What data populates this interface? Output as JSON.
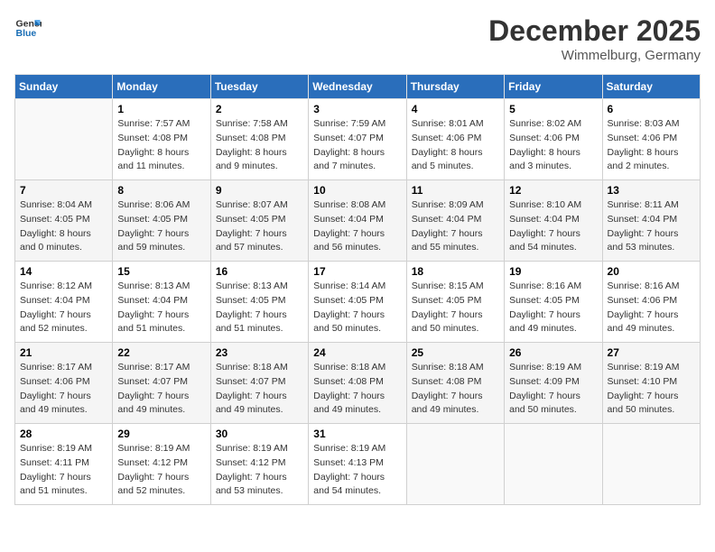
{
  "header": {
    "logo_line1": "General",
    "logo_line2": "Blue",
    "month_title": "December 2025",
    "subtitle": "Wimmelburg, Germany"
  },
  "days_of_week": [
    "Sunday",
    "Monday",
    "Tuesday",
    "Wednesday",
    "Thursday",
    "Friday",
    "Saturday"
  ],
  "weeks": [
    [
      {
        "day": "",
        "info": ""
      },
      {
        "day": "1",
        "info": "Sunrise: 7:57 AM\nSunset: 4:08 PM\nDaylight: 8 hours\nand 11 minutes."
      },
      {
        "day": "2",
        "info": "Sunrise: 7:58 AM\nSunset: 4:08 PM\nDaylight: 8 hours\nand 9 minutes."
      },
      {
        "day": "3",
        "info": "Sunrise: 7:59 AM\nSunset: 4:07 PM\nDaylight: 8 hours\nand 7 minutes."
      },
      {
        "day": "4",
        "info": "Sunrise: 8:01 AM\nSunset: 4:06 PM\nDaylight: 8 hours\nand 5 minutes."
      },
      {
        "day": "5",
        "info": "Sunrise: 8:02 AM\nSunset: 4:06 PM\nDaylight: 8 hours\nand 3 minutes."
      },
      {
        "day": "6",
        "info": "Sunrise: 8:03 AM\nSunset: 4:06 PM\nDaylight: 8 hours\nand 2 minutes."
      }
    ],
    [
      {
        "day": "7",
        "info": "Sunrise: 8:04 AM\nSunset: 4:05 PM\nDaylight: 8 hours\nand 0 minutes."
      },
      {
        "day": "8",
        "info": "Sunrise: 8:06 AM\nSunset: 4:05 PM\nDaylight: 7 hours\nand 59 minutes."
      },
      {
        "day": "9",
        "info": "Sunrise: 8:07 AM\nSunset: 4:05 PM\nDaylight: 7 hours\nand 57 minutes."
      },
      {
        "day": "10",
        "info": "Sunrise: 8:08 AM\nSunset: 4:04 PM\nDaylight: 7 hours\nand 56 minutes."
      },
      {
        "day": "11",
        "info": "Sunrise: 8:09 AM\nSunset: 4:04 PM\nDaylight: 7 hours\nand 55 minutes."
      },
      {
        "day": "12",
        "info": "Sunrise: 8:10 AM\nSunset: 4:04 PM\nDaylight: 7 hours\nand 54 minutes."
      },
      {
        "day": "13",
        "info": "Sunrise: 8:11 AM\nSunset: 4:04 PM\nDaylight: 7 hours\nand 53 minutes."
      }
    ],
    [
      {
        "day": "14",
        "info": "Sunrise: 8:12 AM\nSunset: 4:04 PM\nDaylight: 7 hours\nand 52 minutes."
      },
      {
        "day": "15",
        "info": "Sunrise: 8:13 AM\nSunset: 4:04 PM\nDaylight: 7 hours\nand 51 minutes."
      },
      {
        "day": "16",
        "info": "Sunrise: 8:13 AM\nSunset: 4:05 PM\nDaylight: 7 hours\nand 51 minutes."
      },
      {
        "day": "17",
        "info": "Sunrise: 8:14 AM\nSunset: 4:05 PM\nDaylight: 7 hours\nand 50 minutes."
      },
      {
        "day": "18",
        "info": "Sunrise: 8:15 AM\nSunset: 4:05 PM\nDaylight: 7 hours\nand 50 minutes."
      },
      {
        "day": "19",
        "info": "Sunrise: 8:16 AM\nSunset: 4:05 PM\nDaylight: 7 hours\nand 49 minutes."
      },
      {
        "day": "20",
        "info": "Sunrise: 8:16 AM\nSunset: 4:06 PM\nDaylight: 7 hours\nand 49 minutes."
      }
    ],
    [
      {
        "day": "21",
        "info": "Sunrise: 8:17 AM\nSunset: 4:06 PM\nDaylight: 7 hours\nand 49 minutes."
      },
      {
        "day": "22",
        "info": "Sunrise: 8:17 AM\nSunset: 4:07 PM\nDaylight: 7 hours\nand 49 minutes."
      },
      {
        "day": "23",
        "info": "Sunrise: 8:18 AM\nSunset: 4:07 PM\nDaylight: 7 hours\nand 49 minutes."
      },
      {
        "day": "24",
        "info": "Sunrise: 8:18 AM\nSunset: 4:08 PM\nDaylight: 7 hours\nand 49 minutes."
      },
      {
        "day": "25",
        "info": "Sunrise: 8:18 AM\nSunset: 4:08 PM\nDaylight: 7 hours\nand 49 minutes."
      },
      {
        "day": "26",
        "info": "Sunrise: 8:19 AM\nSunset: 4:09 PM\nDaylight: 7 hours\nand 50 minutes."
      },
      {
        "day": "27",
        "info": "Sunrise: 8:19 AM\nSunset: 4:10 PM\nDaylight: 7 hours\nand 50 minutes."
      }
    ],
    [
      {
        "day": "28",
        "info": "Sunrise: 8:19 AM\nSunset: 4:11 PM\nDaylight: 7 hours\nand 51 minutes."
      },
      {
        "day": "29",
        "info": "Sunrise: 8:19 AM\nSunset: 4:12 PM\nDaylight: 7 hours\nand 52 minutes."
      },
      {
        "day": "30",
        "info": "Sunrise: 8:19 AM\nSunset: 4:12 PM\nDaylight: 7 hours\nand 53 minutes."
      },
      {
        "day": "31",
        "info": "Sunrise: 8:19 AM\nSunset: 4:13 PM\nDaylight: 7 hours\nand 54 minutes."
      },
      {
        "day": "",
        "info": ""
      },
      {
        "day": "",
        "info": ""
      },
      {
        "day": "",
        "info": ""
      }
    ]
  ]
}
